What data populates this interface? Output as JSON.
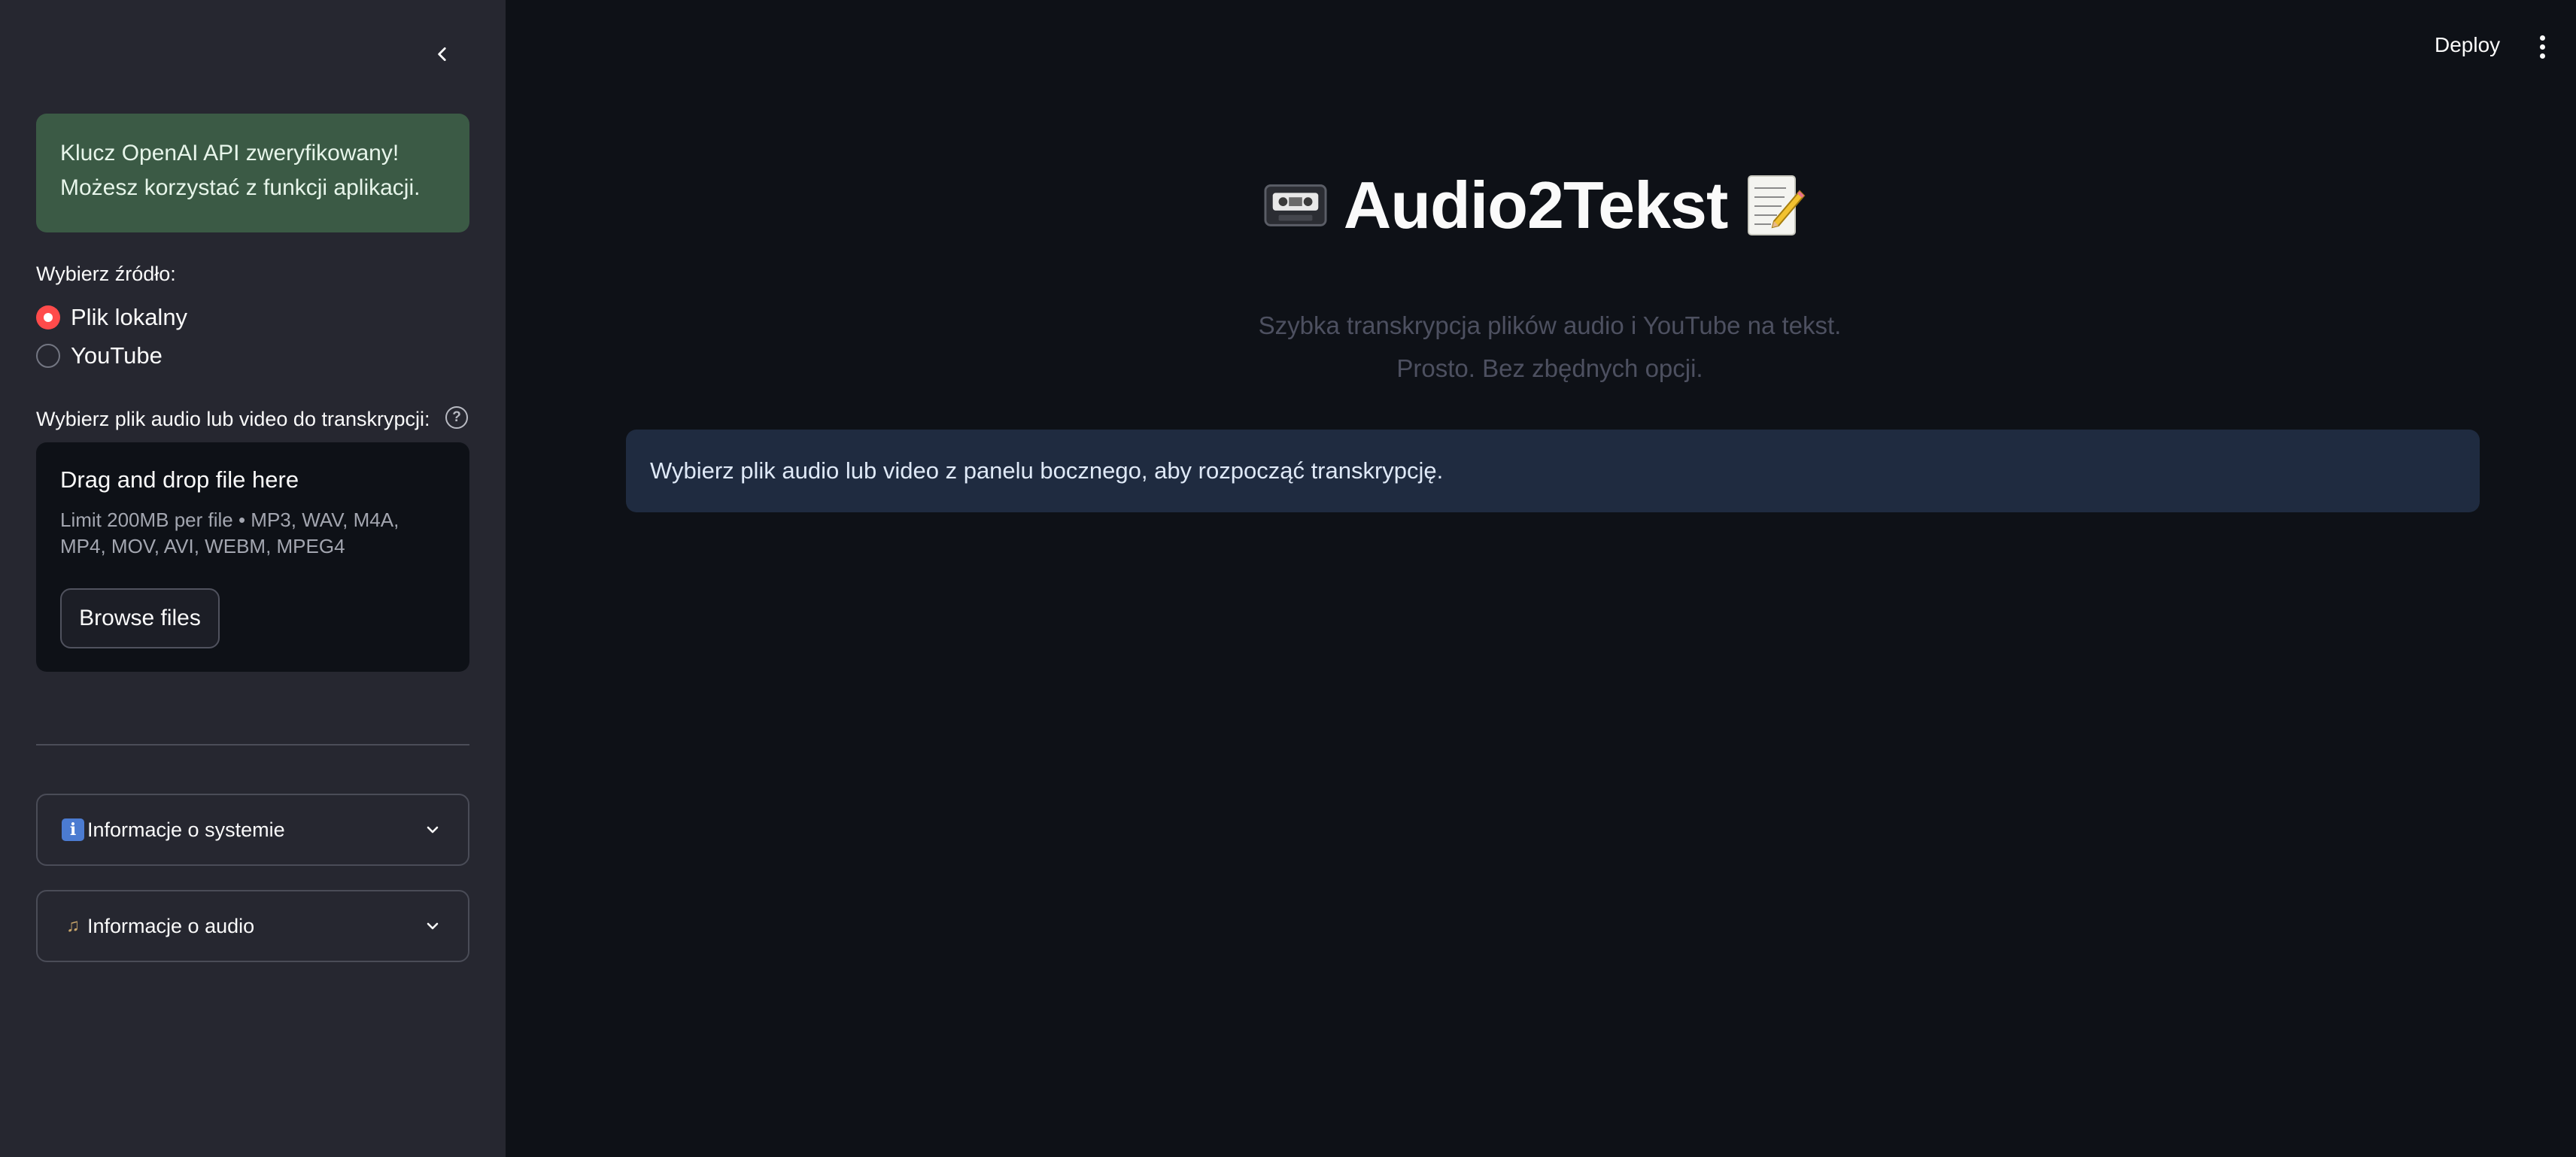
{
  "sidebar": {
    "success_message_line1": "Klucz OpenAI API zweryfikowany!",
    "success_message_line2": "Możesz korzystać z funkcji aplikacji.",
    "source_label": "Wybierz źródło:",
    "source_options": [
      {
        "label": "Plik lokalny",
        "selected": true
      },
      {
        "label": "YouTube",
        "selected": false
      }
    ],
    "upload_label": "Wybierz plik audio lub video do transkrypcji:",
    "dropzone": {
      "title": "Drag and drop file here",
      "limit": "Limit 200MB per file • MP3, WAV, M4A, MP4, MOV, AVI, WEBM, MPEG4",
      "browse_label": "Browse files"
    },
    "expanders": [
      {
        "icon": "info-icon",
        "label": "Informacje o systemie"
      },
      {
        "icon": "musical-note-icon",
        "label": "Informacje o audio"
      }
    ]
  },
  "header": {
    "deploy_label": "Deploy"
  },
  "main": {
    "title": "Audio2Tekst",
    "title_left_icon": "videocassette-icon",
    "title_right_icon": "memo-icon",
    "subtitle_line1": "Szybka transkrypcja plików audio i YouTube na tekst.",
    "subtitle_line2": "Prosto. Bez zbędnych opcji.",
    "info_message": "Wybierz plik audio lub video z panelu bocznego, aby rozpocząć transkrypcję."
  },
  "colors": {
    "sidebar_bg": "#262730",
    "main_bg": "#0e1117",
    "success_bg": "#3b5a45",
    "info_bg": "#1f2b40",
    "accent": "#ff4b4b"
  }
}
